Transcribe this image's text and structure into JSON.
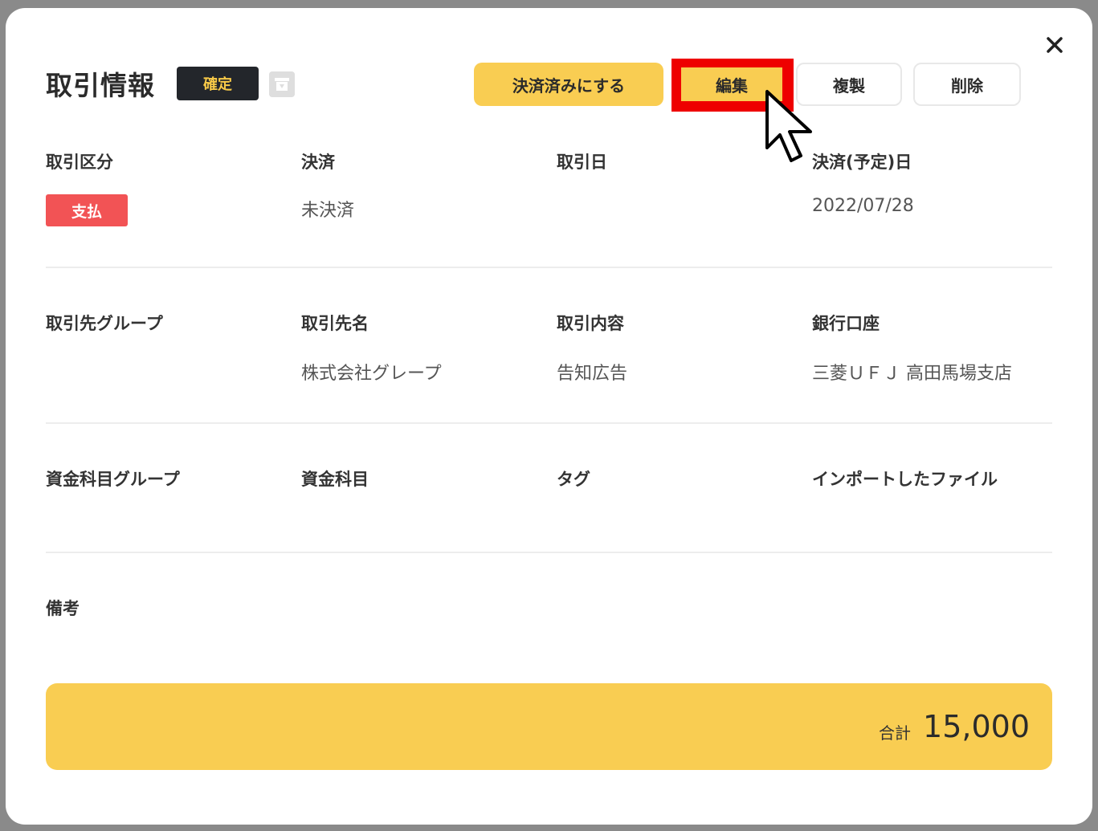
{
  "header": {
    "title": "取引情報",
    "status": "確定",
    "buttons": {
      "settle": "決済済みにする",
      "edit": "編集",
      "copy": "複製",
      "delete": "削除"
    }
  },
  "fields": {
    "row1": [
      {
        "label": "取引区分",
        "value": "支払"
      },
      {
        "label": "決済",
        "value": "未決済"
      },
      {
        "label": "取引日",
        "value": ""
      },
      {
        "label": "決済(予定)日",
        "value": "2022/07/28"
      }
    ],
    "row2": [
      {
        "label": "取引先グループ",
        "value": ""
      },
      {
        "label": "取引先名",
        "value": "株式会社グレープ"
      },
      {
        "label": "取引内容",
        "value": "告知広告"
      },
      {
        "label": "銀行口座",
        "value": "三菱ＵＦＪ 高田馬場支店"
      }
    ],
    "row3": [
      {
        "label": "資金科目グループ",
        "value": ""
      },
      {
        "label": "資金科目",
        "value": ""
      },
      {
        "label": "タグ",
        "value": ""
      },
      {
        "label": "インポートしたファイル",
        "value": ""
      }
    ],
    "row4": [
      {
        "label": "備考",
        "value": ""
      }
    ]
  },
  "total": {
    "label": "合計",
    "value": "15,000"
  },
  "colors": {
    "accent": "#f9cd52",
    "dark": "#23262b",
    "badge_red": "#f25355",
    "highlight_red": "#ee0000"
  },
  "icons": {
    "close": "close-icon",
    "archive": "archive-icon",
    "cursor": "pointer-cursor-icon"
  }
}
